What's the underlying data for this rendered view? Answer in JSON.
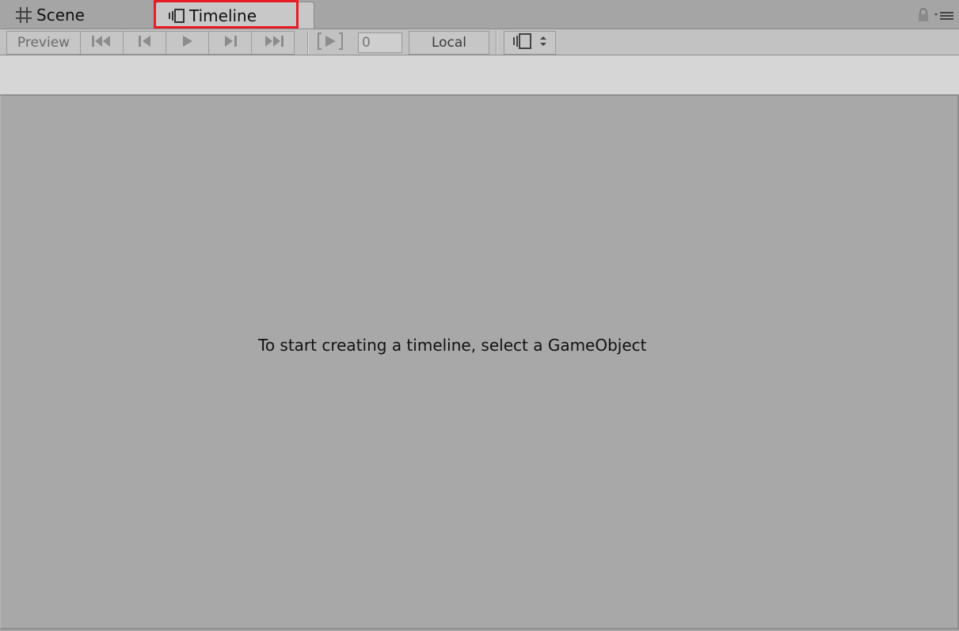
{
  "tabs": [
    {
      "label": "Scene",
      "icon": "grid-icon"
    },
    {
      "label": "Timeline",
      "icon": "timeline-icon"
    }
  ],
  "highlight_color": "#e81c24",
  "toolbar": {
    "preview_label": "Preview",
    "frame_value": "0",
    "time_mode_label": "Local"
  },
  "main": {
    "empty_message": "To start creating a timeline, select a GameObject"
  }
}
